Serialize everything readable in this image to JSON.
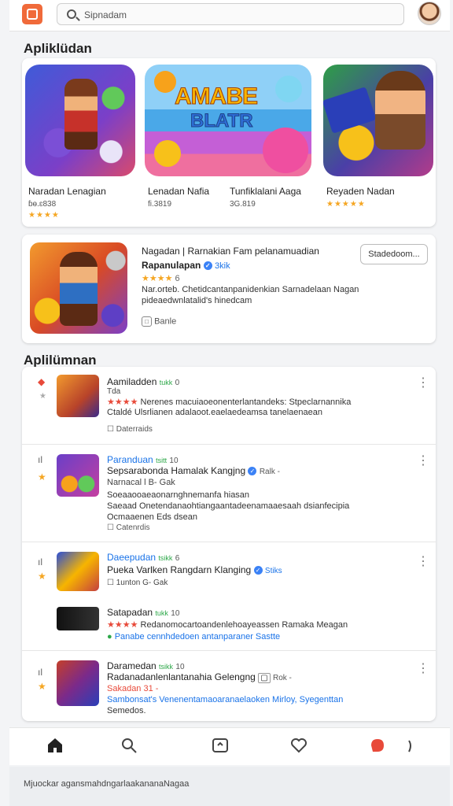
{
  "search": {
    "placeholder": "Sipnadam"
  },
  "section1": {
    "title": "Apliklüdan"
  },
  "tiles": [
    {
      "name": "Naradan Lenagian",
      "meta": "ɓɵ.ɛ838",
      "stars": "★★★★"
    },
    {
      "name": "Lenadan Nafia",
      "meta": "fi.3819"
    },
    {
      "name": "Tunfiklalani Aaga",
      "meta": "3G.819"
    },
    {
      "name": "Reyaden Nadan",
      "stars": "★★★★★"
    }
  ],
  "tile2_art": {
    "line1": "AMABE",
    "line2": "BLATR"
  },
  "featured": {
    "title": "Nagadan | Rarnakian Fam pelanamuadian",
    "subtitle": "Rapanulapan",
    "verified_label": "3kik",
    "rating": "★★★★",
    "rating_num": "6",
    "desc1": "Nar.orteb. Chetidcantanpanidenkian Sarnadelaan Nagan",
    "desc2": "pideaedwnlatalid's hinedcam",
    "tag": "Banle",
    "button": "Stadedoom..."
  },
  "section2": {
    "title": "Aplilümnan"
  },
  "list": [
    {
      "name": "Aamiladden",
      "size": "tukk",
      "num": "0",
      "sub": "Tda",
      "stars": "★★★★",
      "desc1": "Nerenes macuiaoeonenterlantandeks: Stpeclarnannika",
      "desc2": "Ctaldé Ulsrlianen  adalaoot.eaelaedeamsa tanelaenaean",
      "tag": "Daterraids"
    },
    {
      "name": "Paranduan",
      "size": "tsitt",
      "num": "10",
      "sub": "Sepsarabonda  Hamalak Kangjng",
      "verified_label": "Ralk -",
      "sub2": "Narnacal l  B- Gak",
      "desc1": "Soeaaooaeaonarnghnemanfa hiasan",
      "desc2": "Saeaad Onetendanaohtiangaantadeenamaaesaah dsianfecipia",
      "desc3": "Ocmaaenen Eds  dsean",
      "tag": "Catenrdis"
    },
    {
      "name": "Daeepudan",
      "size": "tsikk",
      "num": "6",
      "sub": "Pueka Varlken Rangdarn Klanging",
      "verified_label": "Stiks",
      "sub2": "1unton  G- Gak"
    },
    {
      "name": "Satapadan",
      "size": "tukk",
      "num": "10",
      "stars": "★★★★",
      "desc1": "Redanomocartoandenlehoayeassen Ramaka Meagan",
      "desc2": "Panabe cennhdedoen antanparaner Sastte"
    },
    {
      "name": "Daramedan",
      "size": "tsikk",
      "num": "10",
      "sub": "Radanadanlenlantanahia Gelengng",
      "verified_label": "Rok -",
      "sub2": "Sakadan 31 -",
      "desc1": "Sambonsat's Venenentamaoaranaelaoken Mirloy, Syegenttan",
      "desc2": "Semedos."
    }
  ],
  "footer": {
    "text": "Mjuockar agansmahdngarlaakananaNagaa"
  },
  "colors": {
    "accent": "#f06a3a",
    "star": "#f5a623",
    "verified": "#3b82f6",
    "size_green": "#2ea84a"
  }
}
